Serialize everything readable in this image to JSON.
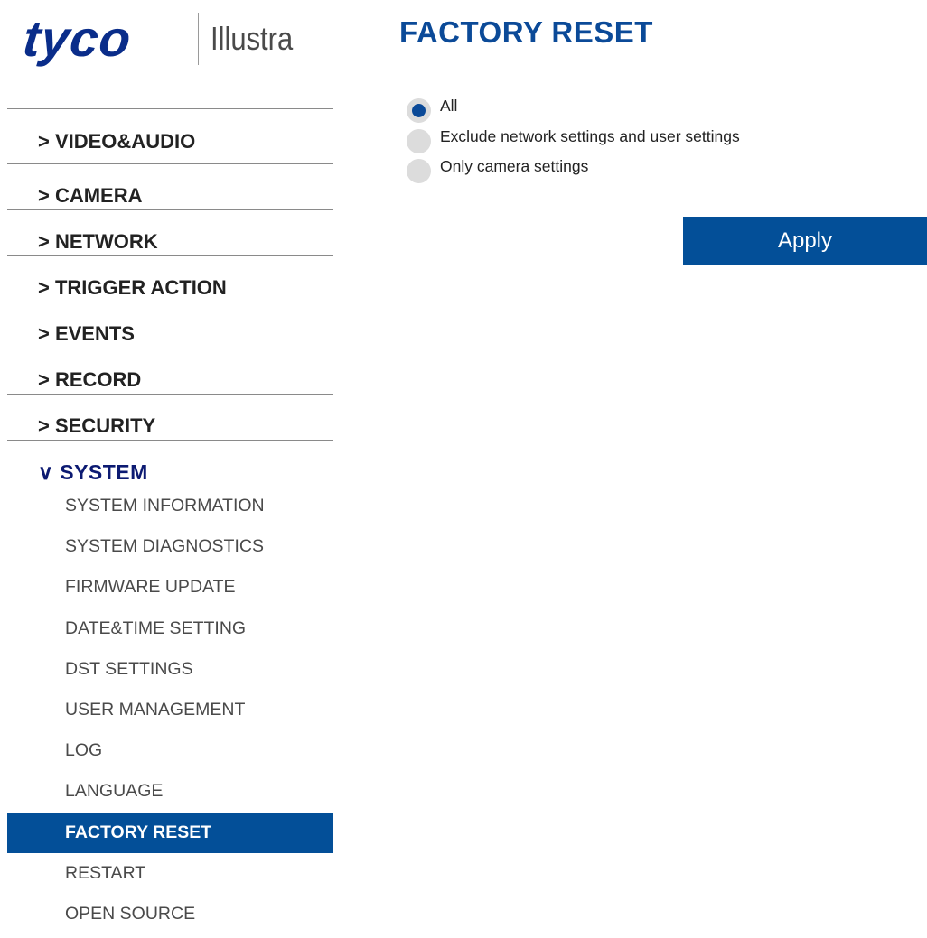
{
  "logo": {
    "brand": "tyco",
    "product": "Illustra"
  },
  "page_title": "FACTORY RESET",
  "nav": {
    "items": [
      {
        "label": "> VIDEO&AUDIO"
      },
      {
        "label": "> CAMERA"
      },
      {
        "label": "> NETWORK"
      },
      {
        "label": "> TRIGGER ACTION"
      },
      {
        "label": "> EVENTS"
      },
      {
        "label": "> RECORD"
      },
      {
        "label": "> SECURITY"
      },
      {
        "label": "∨ SYSTEM"
      }
    ],
    "system_sub": [
      {
        "label": "SYSTEM INFORMATION"
      },
      {
        "label": "SYSTEM DIAGNOSTICS"
      },
      {
        "label": "FIRMWARE UPDATE"
      },
      {
        "label": "DATE&TIME SETTING"
      },
      {
        "label": "DST SETTINGS"
      },
      {
        "label": "USER MANAGEMENT"
      },
      {
        "label": "LOG"
      },
      {
        "label": "LANGUAGE"
      },
      {
        "label": "FACTORY RESET"
      },
      {
        "label": "RESTART"
      },
      {
        "label": "OPEN SOURCE"
      }
    ]
  },
  "reset_options": [
    {
      "label": "All",
      "selected": true
    },
    {
      "label": "Exclude network settings and user settings",
      "selected": false
    },
    {
      "label": "Only camera settings",
      "selected": false
    }
  ],
  "apply_label": "Apply",
  "colors": {
    "accent": "#034f98",
    "title": "#0b4a98",
    "logo": "#0a2d8a",
    "expanded_nav": "#0c1a72"
  }
}
